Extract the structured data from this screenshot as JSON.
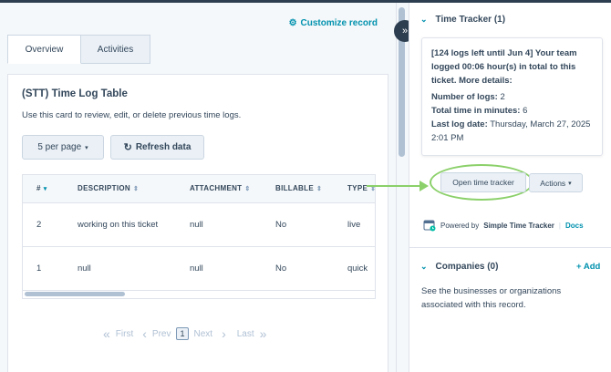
{
  "customize_label": "Customize record",
  "tabs": [
    {
      "label": "Overview"
    },
    {
      "label": "Activities"
    }
  ],
  "card": {
    "title": "(STT) Time Log Table",
    "description": "Use this card to review, edit, or delete previous time logs.",
    "per_page_label": "5 per page",
    "refresh_label": "Refresh data"
  },
  "table": {
    "columns": [
      "#",
      "DESCRIPTION",
      "ATTACHMENT",
      "BILLABLE",
      "TYPE"
    ],
    "rows": [
      {
        "num": "2",
        "description": "working on this ticket",
        "attachment": "null",
        "billable": "No",
        "type": "live"
      },
      {
        "num": "1",
        "description": "null",
        "attachment": "null",
        "billable": "No",
        "type": "quick"
      }
    ]
  },
  "pager": {
    "first": "First",
    "prev": "Prev",
    "current": "1",
    "next": "Next",
    "last": "Last"
  },
  "sidebar": {
    "time_tracker": {
      "title": "Time Tracker (1)",
      "summary": "[124 logs left until Jun 4] Your team logged 00:06 hour(s) in total to this ticket. More details:",
      "num_logs_label": "Number of logs:",
      "num_logs_value": "2",
      "total_time_label": "Total time in minutes:",
      "total_time_value": "6",
      "last_log_label": "Last log date:",
      "last_log_value": "Thursday, March 27, 2025 2:01 PM",
      "open_button": "Open time tracker",
      "actions_button": "Actions",
      "powered_prefix": "Powered by",
      "powered_name": "Simple Time Tracker",
      "docs_link": "Docs"
    },
    "companies": {
      "title": "Companies (0)",
      "add_label": "+ Add",
      "description": "See the businesses or organizations associated with this record."
    }
  },
  "colors": {
    "accent": "#0091ae",
    "highlight": "#8bd06a",
    "dark": "#2d3e50"
  }
}
